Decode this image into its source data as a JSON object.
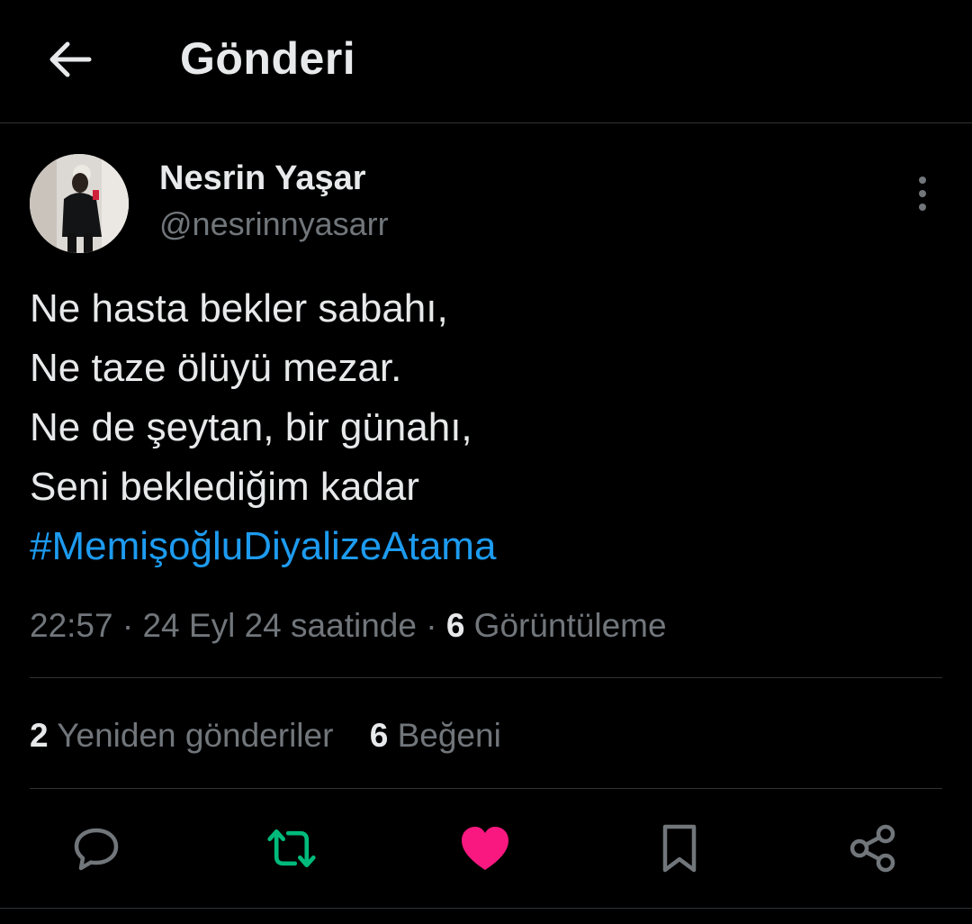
{
  "header": {
    "title": "Gönderi",
    "back_icon": "arrow-left-icon"
  },
  "author": {
    "name": "Nesrin Yaşar",
    "handle": "@nesrinnyasarr"
  },
  "tweet": {
    "lines": [
      "Ne hasta bekler sabahı,",
      "Ne taze ölüyü mezar.",
      "Ne de şeytan, bir günahı,",
      "Seni beklediğim kadar"
    ],
    "hashtag": "#MemişoğluDiyalizeAtama"
  },
  "meta": {
    "time": "22:57",
    "date_text": "24 Eyl 24 saatinde",
    "views_count": "6",
    "views_label": "Görüntüleme",
    "separator": "·"
  },
  "stats": {
    "reposts_count": "2",
    "reposts_label": "Yeniden gönderiler",
    "likes_count": "6",
    "likes_label": "Beğeni"
  },
  "colors": {
    "background": "#000000",
    "text": "#e7e9ea",
    "muted": "#71767b",
    "link": "#1d9bf0",
    "repost_active": "#00ba7c",
    "like_active": "#f91880"
  }
}
